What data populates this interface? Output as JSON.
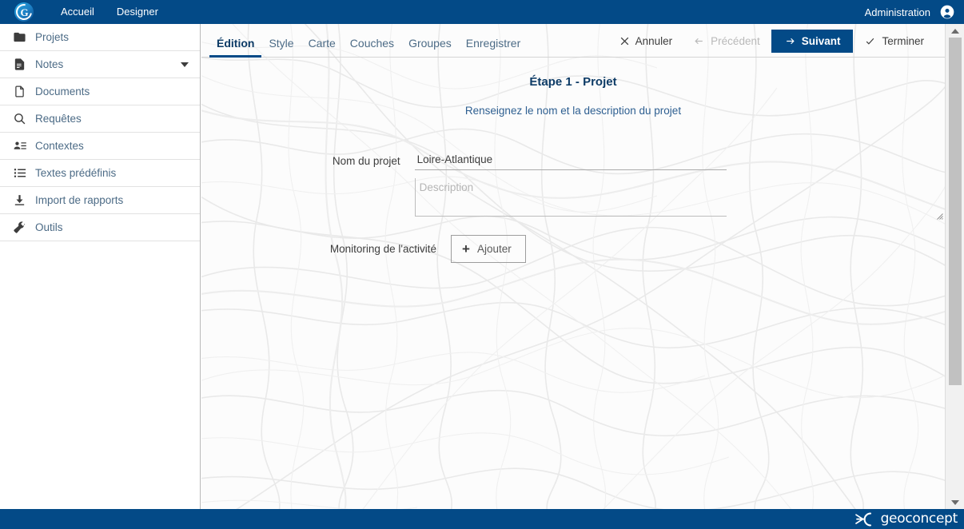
{
  "header": {
    "logo_alt": "geoconcept-logo",
    "nav": [
      {
        "label": "Accueil"
      },
      {
        "label": "Designer"
      }
    ],
    "admin_label": "Administration",
    "avatar_icon": "account-circle-icon",
    "bg_color": "#034a87"
  },
  "sidebar": {
    "items": [
      {
        "label": "Projets",
        "icon": "folder-icon",
        "caret": false
      },
      {
        "label": "Notes",
        "icon": "note-icon",
        "caret": true
      },
      {
        "label": "Documents",
        "icon": "document-icon",
        "caret": false
      },
      {
        "label": "Requêtes",
        "icon": "search-icon",
        "caret": false
      },
      {
        "label": "Contextes",
        "icon": "person-list-icon",
        "caret": false
      },
      {
        "label": "Textes prédéfinis",
        "icon": "list-icon",
        "caret": false
      },
      {
        "label": "Import de rapports",
        "icon": "download-icon",
        "caret": false
      },
      {
        "label": "Outils",
        "icon": "wrench-icon",
        "caret": false
      }
    ]
  },
  "toolbar": {
    "tabs": [
      {
        "label": "Édition",
        "active": true
      },
      {
        "label": "Style",
        "active": false
      },
      {
        "label": "Carte",
        "active": false
      },
      {
        "label": "Couches",
        "active": false
      },
      {
        "label": "Groupes",
        "active": false
      },
      {
        "label": "Enregistrer",
        "active": false
      }
    ],
    "actions": {
      "cancel_label": "Annuler",
      "previous_label": "Précédent",
      "next_label": "Suivant",
      "finish_label": "Terminer"
    },
    "accent_color": "#034a87"
  },
  "wizard": {
    "step_title": "Étape 1 - Projet",
    "step_subtitle": "Renseignez le nom et la description du projet",
    "fields": {
      "project_name_label": "Nom du projet",
      "project_name_value": "Loire-Atlantique",
      "description_placeholder": "Description",
      "description_value": "",
      "monitoring_label": "Monitoring de l'activité",
      "add_button_label": "Ajouter"
    }
  },
  "scrollbar": {
    "up_arrow": "triangle-up-icon",
    "down_arrow": "triangle-down-icon"
  },
  "footer": {
    "brand": "geoconcept",
    "bg_color": "#034a87"
  }
}
